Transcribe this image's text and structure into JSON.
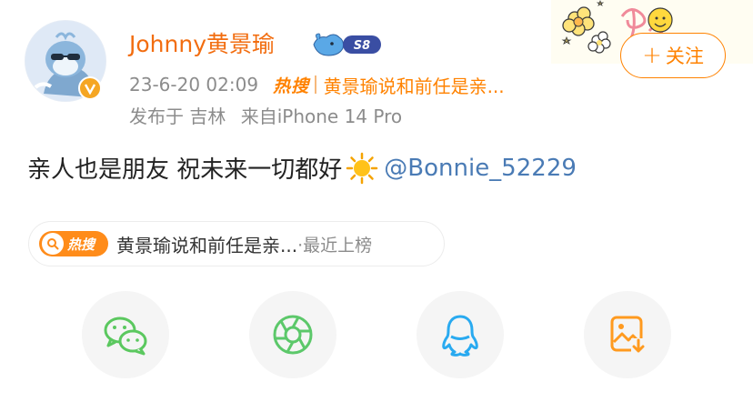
{
  "author": {
    "name": "Johnny黄景瑜",
    "member_badge": "S8",
    "verified_icon": "v-verified-icon"
  },
  "meta": {
    "time": "23-6-20 02:09",
    "hot_label": "热搜",
    "hot_topic": "黄景瑜说和前任是亲...",
    "location": "发布于 吉林",
    "source": "来自iPhone 14 Pro"
  },
  "follow": {
    "plus": "+",
    "label": "关注"
  },
  "post": {
    "text": "亲人也是朋友 祝未来一切都好",
    "emoji": "sun-emoji",
    "mention": "@Bonnie_52229"
  },
  "hot_chip": {
    "badge": "热搜",
    "topic": "黄景瑜说和前任是亲...",
    "tail": "·最近上榜"
  },
  "share": {
    "items": [
      "wechat-icon",
      "moments-icon",
      "qq-icon",
      "save-image-icon"
    ]
  },
  "colors": {
    "accent": "#ff8200",
    "name": "#f26d10",
    "mention": "#4a7bb5",
    "wechat": "#5bc85f",
    "moments": "#5cc86a",
    "qq": "#29aaf0",
    "save": "#ff9a1f"
  }
}
